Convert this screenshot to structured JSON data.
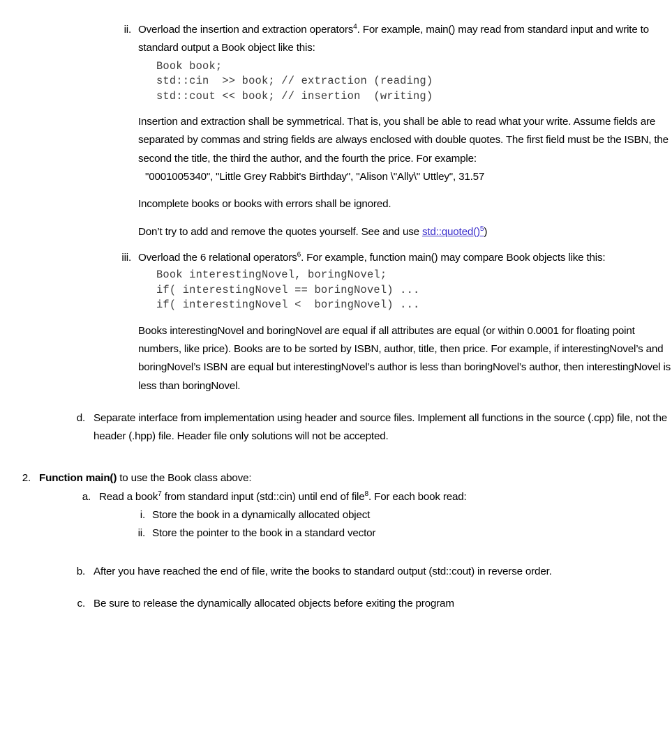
{
  "document": {
    "type": "assignment-handout",
    "background_color": "#ffffff",
    "text_color": "#000000",
    "link_color": "#3a2ecb",
    "code_color": "#3b3b3b"
  },
  "items": {
    "ii": {
      "marker": "ii.",
      "lead_1": "Overload the insertion and extraction operators",
      "lead_1_sup": "4",
      "lead_2": ". For example, main() may read from standard input and write to standard output a Book object like this:",
      "code": "Book book;\nstd::cin  >> book; // extraction (reading)\nstd::cout << book; // insertion  (writing)",
      "para_1": "Insertion and extraction shall be symmetrical.  That is, you shall be able to read what your write.  Assume fields are separated by commas and string fields are always enclosed with double quotes.  The first field must be the ISBN, the second the title, the third the author, and the fourth the price.  For example:",
      "example": "\"0001005340\", \"Little Grey Rabbit's Birthday\", \"Alison \\\"Ally\\\" Uttley\", 31.57",
      "para_2": "Incomplete books or books with errors shall be ignored.",
      "para_3_pre": "Don’t try to add and remove the quotes yourself. See and use ",
      "para_3_link": "std::quoted()",
      "para_3_link_sup": "5",
      "para_3_post": ")"
    },
    "iii": {
      "marker": "iii.",
      "lead_1": "Overload the 6 relational operators",
      "lead_1_sup": "6",
      "lead_2": ". For example, function main() may compare Book objects like this:",
      "code": "Book interestingNovel, boringNovel;\nif( interestingNovel == boringNovel) ...\nif( interestingNovel <  boringNovel) ...",
      "para_1": "Books interestingNovel and boringNovel are equal if all attributes are equal (or within 0.0001 for floating point numbers, like price).  Books are to be sorted by ISBN, author, title, then price.  For example, if interestingNovel’s and boringNovel’s ISBN are equal but interestingNovel’s author is less than boringNovel’s author, then interestingNovel is less than boringNovel."
    },
    "d": {
      "marker": "d.",
      "text": "Separate interface from implementation using header and source files.  Implement all functions in the source (.cpp) file, not the header (.hpp) file.  Header file only solutions will not be accepted."
    },
    "section2": {
      "marker": "2.",
      "title_bold": "Function main()",
      "title_rest": " to use the Book class above:",
      "a": {
        "marker": "a.",
        "text_1": "Read a book",
        "sup_1": "7",
        "text_2": " from standard input (std::cin) until end of file",
        "sup_2": "8",
        "text_3": ". For each book read:",
        "sub": [
          {
            "marker": "i.",
            "text": "Store the book in a dynamically allocated object"
          },
          {
            "marker": "ii.",
            "text": "Store the pointer to the book in a standard vector"
          }
        ]
      },
      "b": {
        "marker": "b.",
        "text": "After you have reached the end of file, write the books to standard output (std::cout) in reverse order."
      },
      "c": {
        "marker": "c.",
        "text": "Be sure to release the dynamically allocated objects before exiting the program"
      }
    }
  }
}
